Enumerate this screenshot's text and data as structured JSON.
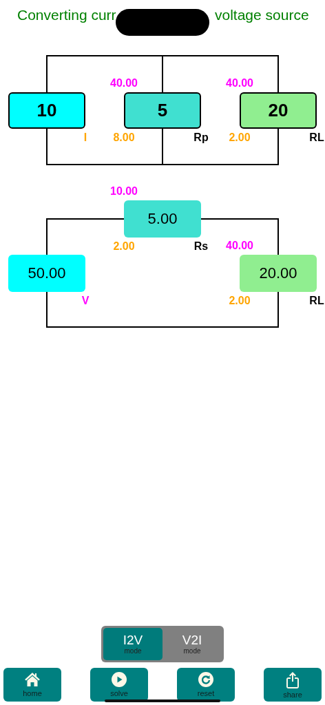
{
  "title": {
    "start": "Converting curr",
    "end": "voltage source"
  },
  "circuits": [
    {
      "kind": "parallel",
      "components": [
        {
          "kind": "current-source",
          "value": "10",
          "color": "#00ffff",
          "symbol": "I"
        },
        {
          "kind": "resistor",
          "value": "5",
          "color": "#40e0d0",
          "top_reading": "40.00",
          "bottom_reading": "8.00",
          "symbol": "Rp"
        },
        {
          "kind": "resistor",
          "value": "20",
          "color": "#90ee90",
          "top_reading": "40.00",
          "bottom_reading": "2.00",
          "symbol": "RL"
        }
      ]
    },
    {
      "kind": "series",
      "components": [
        {
          "kind": "voltage-source",
          "value": "50.00",
          "color": "#00ffff",
          "symbol": "V"
        },
        {
          "kind": "resistor",
          "value": "5.00",
          "color": "#40e0d0",
          "top_reading": "10.00",
          "bottom_reading": "2.00",
          "symbol": "Rs"
        },
        {
          "kind": "resistor",
          "value": "20.00",
          "color": "#90ee90",
          "top_reading": "40.00",
          "bottom_reading": "2.00",
          "symbol": "RL"
        }
      ]
    }
  ],
  "modes": [
    {
      "label": "I2V",
      "sublabel": "mode",
      "selected": true
    },
    {
      "label": "V2I",
      "sublabel": "mode",
      "selected": false
    }
  ],
  "toolbar": [
    {
      "kind": "home",
      "label": "home"
    },
    {
      "kind": "solve",
      "label": "solve"
    },
    {
      "kind": "reset",
      "label": "reset"
    },
    {
      "kind": "share",
      "label": "share"
    }
  ]
}
